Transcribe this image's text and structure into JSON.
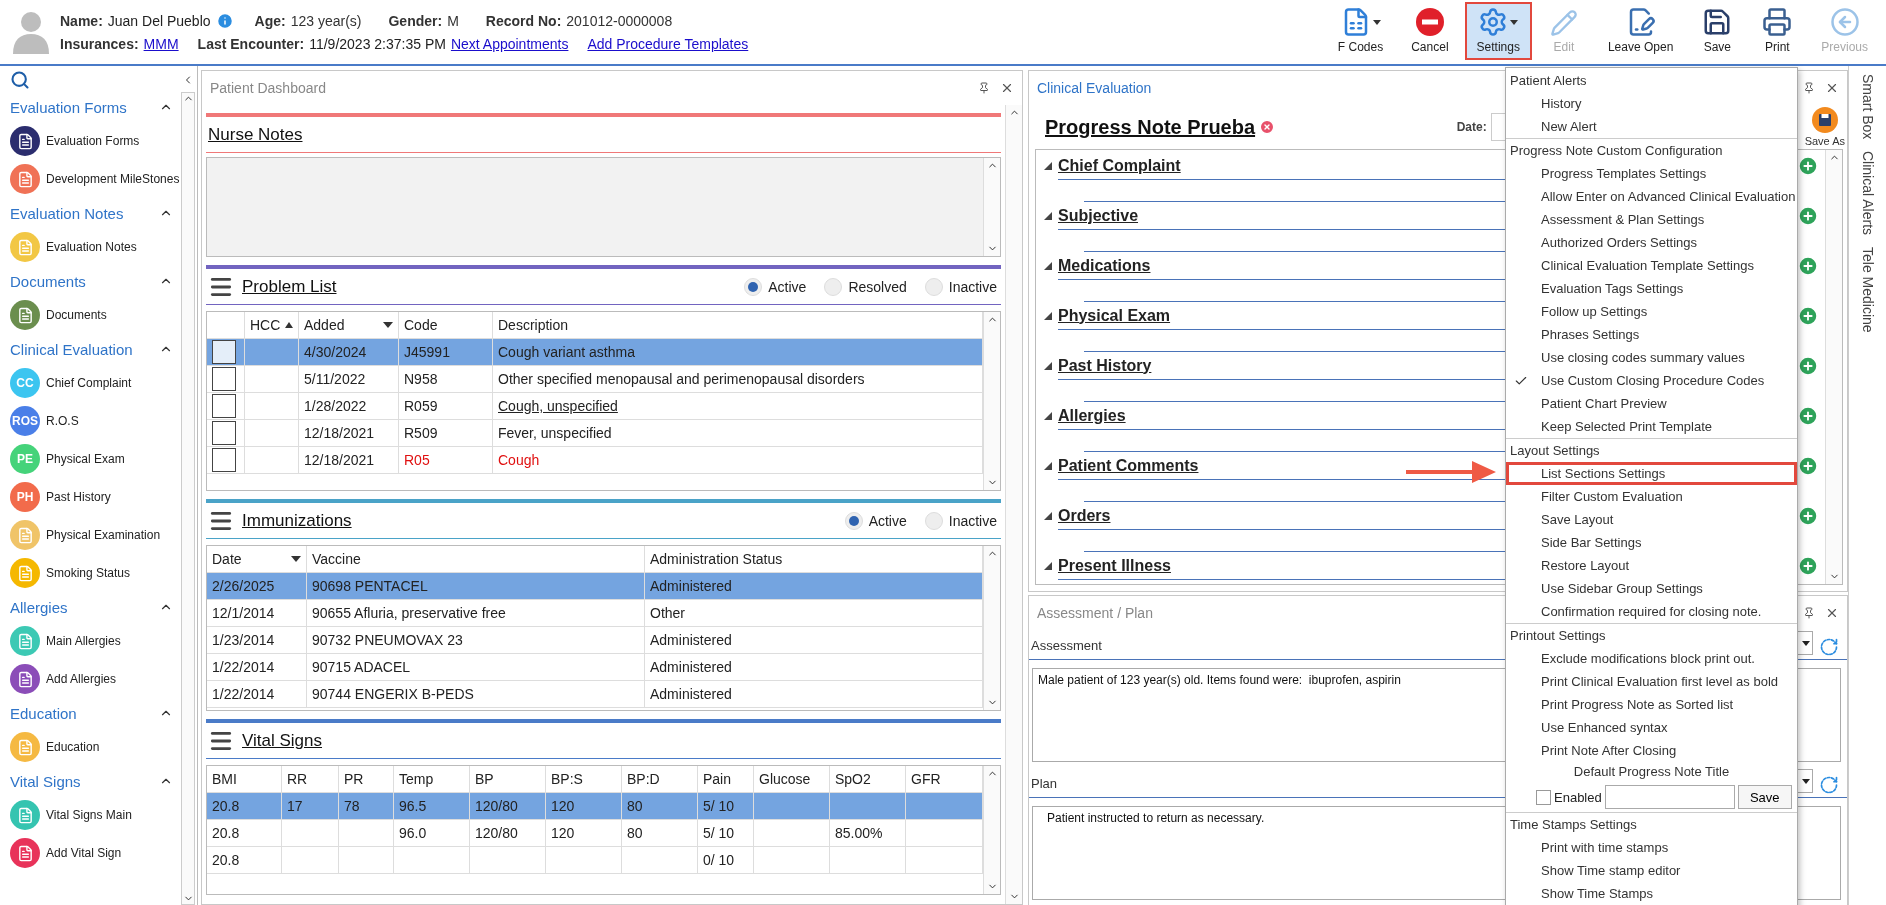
{
  "patient": {
    "name_label": "Name:",
    "name": "Juan Del Pueblo",
    "age_label": "Age:",
    "age": "123 year(s)",
    "gender_label": "Gender:",
    "gender": "M",
    "record_label": "Record No:",
    "record": "201012-0000008",
    "insurances_label": "Insurances:",
    "insurance": "MMM",
    "last_encounter_label": "Last Encounter:",
    "last_encounter": "11/9/2023 2:37:35 PM",
    "links": [
      "Next Appointments",
      "Add Procedure Templates"
    ]
  },
  "toolbar": [
    {
      "label": "F Codes",
      "dropdown": true,
      "disabled": false,
      "selected": false,
      "annotated": false
    },
    {
      "label": "Cancel",
      "dropdown": false,
      "disabled": false,
      "selected": false,
      "annotated": false
    },
    {
      "label": "Settings",
      "dropdown": true,
      "disabled": false,
      "selected": true,
      "annotated": true
    },
    {
      "label": "Edit",
      "dropdown": false,
      "disabled": true,
      "selected": false,
      "annotated": false
    },
    {
      "label": "Leave Open",
      "dropdown": false,
      "disabled": false,
      "selected": false,
      "annotated": false
    },
    {
      "label": "Save",
      "dropdown": false,
      "disabled": false,
      "selected": false,
      "annotated": false
    },
    {
      "label": "Print",
      "dropdown": false,
      "disabled": false,
      "selected": false,
      "annotated": false
    },
    {
      "label": "Previous",
      "dropdown": false,
      "disabled": true,
      "selected": false,
      "annotated": false
    }
  ],
  "sidebar": {
    "groups": [
      {
        "title": "Evaluation Forms",
        "expanded": true,
        "items": [
          {
            "label": "Evaluation Forms",
            "color": "#2b2d6e"
          },
          {
            "label": "Development MileStones",
            "color": "#f07256"
          }
        ]
      },
      {
        "title": "Evaluation Notes",
        "expanded": true,
        "items": [
          {
            "label": "Evaluation Notes",
            "color": "#f2c744"
          }
        ]
      },
      {
        "title": "Documents",
        "expanded": true,
        "items": [
          {
            "label": "Documents",
            "color": "#6b8e4e"
          }
        ]
      },
      {
        "title": "Clinical Evaluation",
        "expanded": true,
        "items": [
          {
            "label": "Chief Complaint",
            "color": "#3cc5f0",
            "badge": "CC"
          },
          {
            "label": "R.O.S",
            "color": "#4a7fe8",
            "badge": "ROS"
          },
          {
            "label": "Physical Exam",
            "color": "#45d37a",
            "badge": "PE"
          },
          {
            "label": "Past History",
            "color": "#f26b4b",
            "badge": "PH"
          },
          {
            "label": "Physical Examination",
            "color": "#f0c468"
          },
          {
            "label": "Smoking Status",
            "color": "#f5b800"
          }
        ]
      },
      {
        "title": "Allergies",
        "expanded": true,
        "items": [
          {
            "label": "Main Allergies",
            "color": "#3cc9b4"
          },
          {
            "label": "Add Allergies",
            "color": "#8b4db8"
          }
        ]
      },
      {
        "title": "Education",
        "expanded": true,
        "items": [
          {
            "label": "Education",
            "color": "#f5b942"
          }
        ]
      },
      {
        "title": "Vital Signs",
        "expanded": true,
        "items": [
          {
            "label": "Vital Signs Main",
            "color": "#35c4b0"
          },
          {
            "label": "Add Vital Sign",
            "color": "#e8335a"
          }
        ]
      }
    ]
  },
  "dashboard": {
    "title": "Patient Dashboard",
    "nurse_notes": {
      "title": "Nurse Notes"
    },
    "problem_list": {
      "title": "Problem List",
      "filters": [
        {
          "label": "Active",
          "selected": true
        },
        {
          "label": "Resolved",
          "selected": false
        },
        {
          "label": "Inactive",
          "selected": false
        }
      ],
      "columns": [
        {
          "label": "HCC",
          "sorted": true,
          "ascending": true
        },
        {
          "label": "Added",
          "sorted": true,
          "ascending": false
        },
        {
          "label": "Code",
          "sorted": false
        },
        {
          "label": "Description",
          "sorted": false
        }
      ],
      "rows": [
        {
          "added": "4/30/2024",
          "code": "J45991",
          "description": "Cough variant asthma",
          "selected": true,
          "checked": false,
          "alert": false,
          "hovered": false
        },
        {
          "added": "5/11/2022",
          "code": "N958",
          "description": "Other specified menopausal and perimenopausal disorders",
          "selected": false,
          "checked": false,
          "alert": false,
          "hovered": false
        },
        {
          "added": "1/28/2022",
          "code": "R059",
          "description": "Cough, unspecified",
          "selected": false,
          "checked": false,
          "alert": false,
          "hovered": true
        },
        {
          "added": "12/18/2021",
          "code": "R509",
          "description": "Fever, unspecified",
          "selected": false,
          "checked": false,
          "alert": false,
          "hovered": false
        },
        {
          "added": "12/18/2021",
          "code": "R05",
          "description": "Cough",
          "selected": false,
          "checked": false,
          "alert": true,
          "hovered": false
        }
      ]
    },
    "immunizations": {
      "title": "Immunizations",
      "filters": [
        {
          "label": "Active",
          "selected": true
        },
        {
          "label": "Inactive",
          "selected": false
        }
      ],
      "columns": [
        {
          "label": "Date",
          "sorted": true,
          "ascending": false
        },
        {
          "label": "Vaccine",
          "sorted": false
        },
        {
          "label": "Administration Status",
          "sorted": false
        }
      ],
      "rows": [
        {
          "cells": [
            "2/26/2025",
            "90698 PENTACEL",
            "Administered"
          ],
          "selected": true
        },
        {
          "cells": [
            "12/1/2014",
            "90655 Afluria, preservative free",
            "Other"
          ],
          "selected": false
        },
        {
          "cells": [
            "1/23/2014",
            "90732 PNEUMOVAX 23",
            "Administered"
          ],
          "selected": false
        },
        {
          "cells": [
            "1/22/2014",
            "90715 ADACEL",
            "Administered"
          ],
          "selected": false
        },
        {
          "cells": [
            "1/22/2014",
            "90744 ENGERIX B-PEDS",
            "Administered"
          ],
          "selected": false
        }
      ]
    },
    "vital_signs": {
      "title": "Vital Signs",
      "columns": [
        "BMI",
        "RR",
        "PR",
        "Temp",
        "BP",
        "BP:S",
        "BP:D",
        "Pain",
        "Glucose",
        "SpO2",
        "GFR"
      ],
      "rows": [
        {
          "bmi": "20.8",
          "rr": "17",
          "pr": "78",
          "temp": "96.5",
          "bp": "120/80",
          "bps": "120",
          "bpd": "80",
          "pain": "5/ 10",
          "selected": true
        },
        {
          "bmi": "20.8",
          "temp": "96.0",
          "bp": "120/80",
          "bps": "120",
          "bpd": "80",
          "pain": "5/ 10",
          "spo2": "85.00%",
          "selected": false
        },
        {
          "bmi": "20.8",
          "pain": "0/ 10",
          "selected": false
        }
      ]
    }
  },
  "clinical": {
    "title": "Clinical Evaluation",
    "note_title": "Progress Note Prueba",
    "date_label": "Date:",
    "save_as": "Save As",
    "sections": [
      {
        "title": "Chief Complaint",
        "expanded": true
      },
      {
        "title": "Subjective",
        "expanded": true
      },
      {
        "title": "Medications",
        "expanded": true
      },
      {
        "title": "Physical Exam",
        "expanded": true
      },
      {
        "title": "Past History",
        "expanded": true
      },
      {
        "title": "Allergies",
        "expanded": true
      },
      {
        "title": "Patient Comments",
        "expanded": true
      },
      {
        "title": "Orders",
        "expanded": true
      },
      {
        "title": "Present Illness",
        "expanded": true
      }
    ]
  },
  "assessment_plan": {
    "title": "Assessment / Plan",
    "assessment_label": "Assessment",
    "assessment_text": "Male patient of 123 year(s) old. Items found were:  ibuprofen, aspirin",
    "plan_label": "Plan",
    "plan_text": "Patient instructed to return as necessary."
  },
  "side_tabs": [
    "Smart Box",
    "Clinical Alerts",
    "Tele Medicine"
  ],
  "settings_menu": {
    "groups": [
      {
        "title": "Patient Alerts",
        "items": [
          {
            "label": "History",
            "checked": false,
            "annotated": false
          },
          {
            "label": "New Alert",
            "checked": false,
            "annotated": false
          }
        ]
      },
      {
        "title": "Progress Note Custom Configuration",
        "items": [
          {
            "label": "Progress Templates Settings",
            "checked": false,
            "annotated": false
          },
          {
            "label": "Allow Enter on Advanced Clinical Evaluation",
            "checked": false,
            "annotated": false
          },
          {
            "label": "Assessment & Plan Settings",
            "checked": false,
            "annotated": false
          },
          {
            "label": "Authorized Orders Settings",
            "checked": false,
            "annotated": false
          },
          {
            "label": "Clinical Evaluation Template Settings",
            "checked": false,
            "annotated": false
          },
          {
            "label": "Evaluation Tags Settings",
            "checked": false,
            "annotated": false
          },
          {
            "label": "Follow up Settings",
            "checked": false,
            "annotated": false
          },
          {
            "label": "Phrases Settings",
            "checked": false,
            "annotated": false
          },
          {
            "label": "Use closing codes summary values",
            "checked": false,
            "annotated": false
          },
          {
            "label": "Use Custom Closing Procedure Codes",
            "checked": true,
            "annotated": false
          },
          {
            "label": "Patient Chart Preview",
            "checked": false,
            "annotated": false
          },
          {
            "label": "Keep Selected Print Template",
            "checked": false,
            "annotated": false
          }
        ]
      },
      {
        "title": "Layout Settings",
        "items": [
          {
            "label": "List Sections Settings",
            "checked": false,
            "annotated": true
          },
          {
            "label": "Filter Custom Evaluation",
            "checked": false,
            "annotated": false
          },
          {
            "label": "Save Layout",
            "checked": false,
            "annotated": false
          },
          {
            "label": "Side Bar Settings",
            "checked": false,
            "annotated": false
          },
          {
            "label": "Restore Layout",
            "checked": false,
            "annotated": false
          },
          {
            "label": "Use Sidebar Group Settings",
            "checked": false,
            "annotated": false
          },
          {
            "label": "Confirmation required for closing note.",
            "checked": false,
            "annotated": false
          }
        ]
      },
      {
        "title": "Printout Settings",
        "items": [
          {
            "label": "Exclude modifications block print out.",
            "checked": false,
            "annotated": false
          },
          {
            "label": "Print Clinical Evaluation first level as bold",
            "checked": false,
            "annotated": false
          },
          {
            "label": "Print Progress Note as Sorted list",
            "checked": false,
            "annotated": false
          },
          {
            "label": "Use Enhanced syntax",
            "checked": false,
            "annotated": false
          },
          {
            "label": "Print Note After Closing",
            "checked": false,
            "annotated": false
          }
        ],
        "default_title": {
          "label": "Default Progress Note Title",
          "checkbox_label": "Enabled",
          "checked": false,
          "button": "Save"
        }
      },
      {
        "title": "Time Stamps Settings",
        "items": [
          {
            "label": "Print with time stamps",
            "checked": false,
            "annotated": false
          },
          {
            "label": "Show Time stamp editor",
            "checked": false,
            "annotated": false
          },
          {
            "label": "Show Time Stamps",
            "checked": false,
            "annotated": false
          }
        ]
      }
    ]
  }
}
